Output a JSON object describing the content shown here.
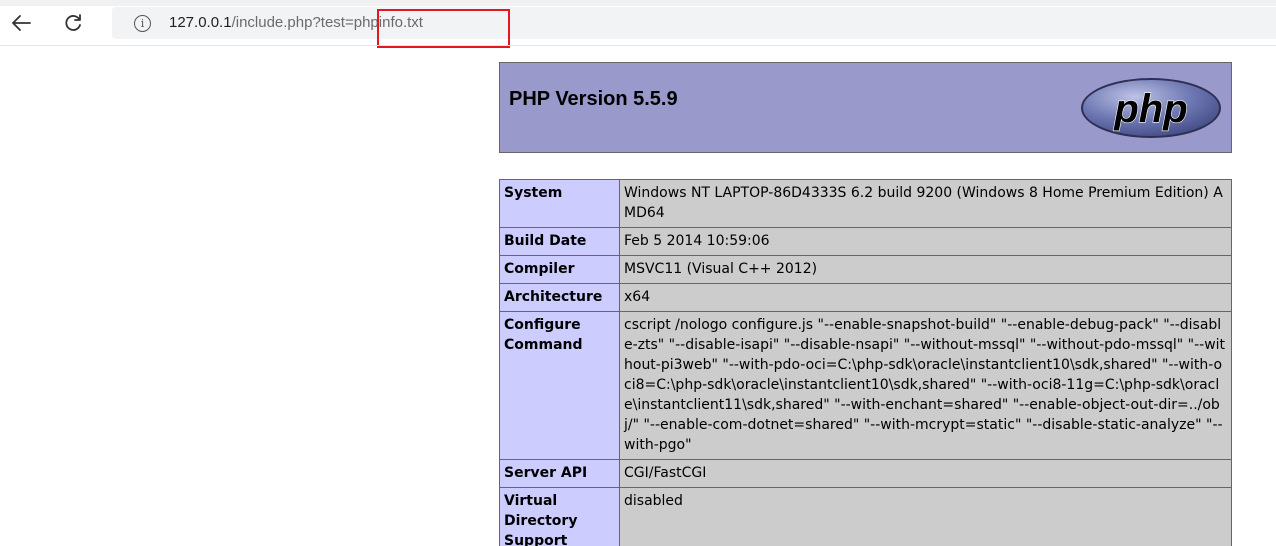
{
  "browser": {
    "url_host": "127.0.0.1",
    "url_path": "/include.php?test=phpinfo.txt",
    "info_glyph": "i",
    "icons": {
      "back": "arrow-left-icon",
      "reload": "reload-icon",
      "info": "info-icon"
    },
    "highlight_color": "#e0191f"
  },
  "php": {
    "title": "PHP Version 5.5.9",
    "logo_text": "php",
    "header_color": "#9999cc",
    "key_color": "#ccccff",
    "value_color": "#cccccc",
    "rows": [
      {
        "key": "System",
        "value": "Windows NT LAPTOP-86D4333S 6.2 build 9200 (Windows 8 Home Premium Edition) AMD64"
      },
      {
        "key": "Build Date",
        "value": "Feb 5 2014 10:59:06"
      },
      {
        "key": "Compiler",
        "value": "MSVC11 (Visual C++ 2012)"
      },
      {
        "key": "Architecture",
        "value": "x64"
      },
      {
        "key": "Configure Command",
        "value": "cscript /nologo configure.js \"--enable-snapshot-build\" \"--enable-debug-pack\" \"--disable-zts\" \"--disable-isapi\" \"--disable-nsapi\" \"--without-mssql\" \"--without-pdo-mssql\" \"--without-pi3web\" \"--with-pdo-oci=C:\\php-sdk\\oracle\\instantclient10\\sdk,shared\" \"--with-oci8=C:\\php-sdk\\oracle\\instantclient10\\sdk,shared\" \"--with-oci8-11g=C:\\php-sdk\\oracle\\instantclient11\\sdk,shared\" \"--with-enchant=shared\" \"--enable-object-out-dir=../obj/\" \"--enable-com-dotnet=shared\" \"--with-mcrypt=static\" \"--disable-static-analyze\" \"--with-pgo\""
      },
      {
        "key": "Server API",
        "value": "CGI/FastCGI"
      },
      {
        "key": "Virtual Directory Support",
        "value": "disabled"
      }
    ]
  }
}
